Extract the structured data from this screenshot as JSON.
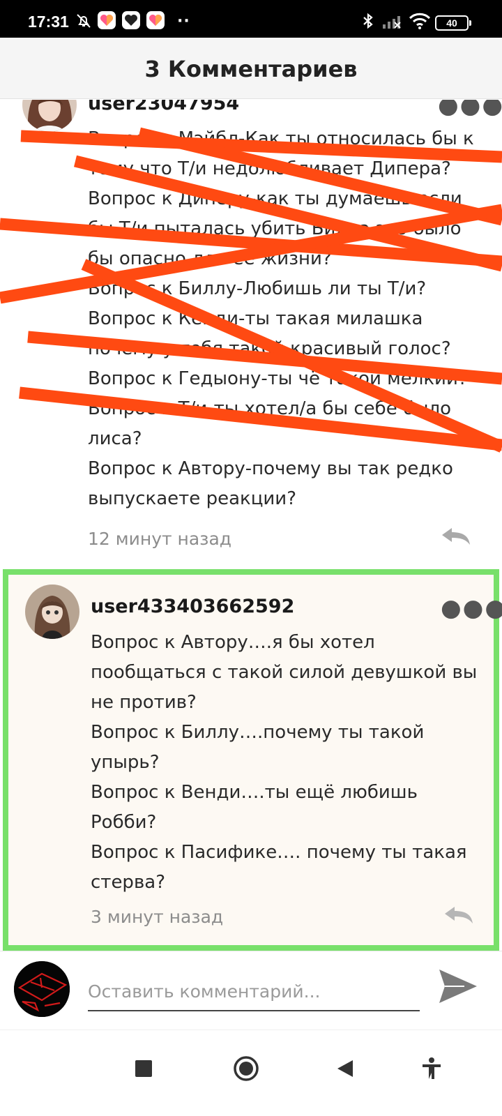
{
  "status_bar": {
    "time": "17:31",
    "overflow": "··",
    "battery": "40",
    "icons": [
      "bell-off-icon",
      "app-heart-icon",
      "app-heart-icon",
      "app-heart-icon",
      "bluetooth-icon",
      "signal-icon",
      "wifi-icon",
      "battery-icon"
    ]
  },
  "header": {
    "title": "3 Комментариев"
  },
  "comments": [
    {
      "username": "user23047954",
      "lines": [
        "Вопрос к Мэйбл-Как ты относилась бы к",
        "тому что Т/и недолюбливает Дипера?",
        "Вопрос к Диперу-как ты думаешь если",
        "бы Т/и пыталась убить Билла это было",
        "бы опасно для её жизни?",
        "Вопрос к Биллу-Любишь ли ты Т/и?",
        "Вопрос к Кенди-ты такая милашка",
        "почему у тебя такой красивый голос?",
        "Вопрос к Гедыону-ты чё такой мелкий?",
        "Вопрос к Т/и-ты хотел/а бы себе было",
        "лиса?",
        "Вопрос к Автору-почему вы так редко",
        "выпускаете реакции?"
      ],
      "time_ago": "12 минут назад",
      "crossed_out": true
    },
    {
      "username": "user433403662592",
      "lines": [
        "Вопрос к Автору….я бы хотел",
        "пообщаться с такой силой девушкой вы",
        "не против?",
        "Вопрос к Биллу….почему ты такой",
        "упырь?",
        "Вопрос к Венди….ты ещё любишь",
        "Робби?",
        "Вопрос к Пасифике…. почему ты такая",
        "стерва?"
      ],
      "time_ago": "3 минут назад",
      "highlighted": true
    }
  ],
  "composer": {
    "placeholder": "Оставить комментарий..."
  },
  "colors": {
    "scribble": "#ff4a12",
    "highlight": "#78e06a"
  },
  "nav": [
    "recents-square-icon",
    "home-circle-icon",
    "back-triangle-icon",
    "accessibility-icon"
  ]
}
